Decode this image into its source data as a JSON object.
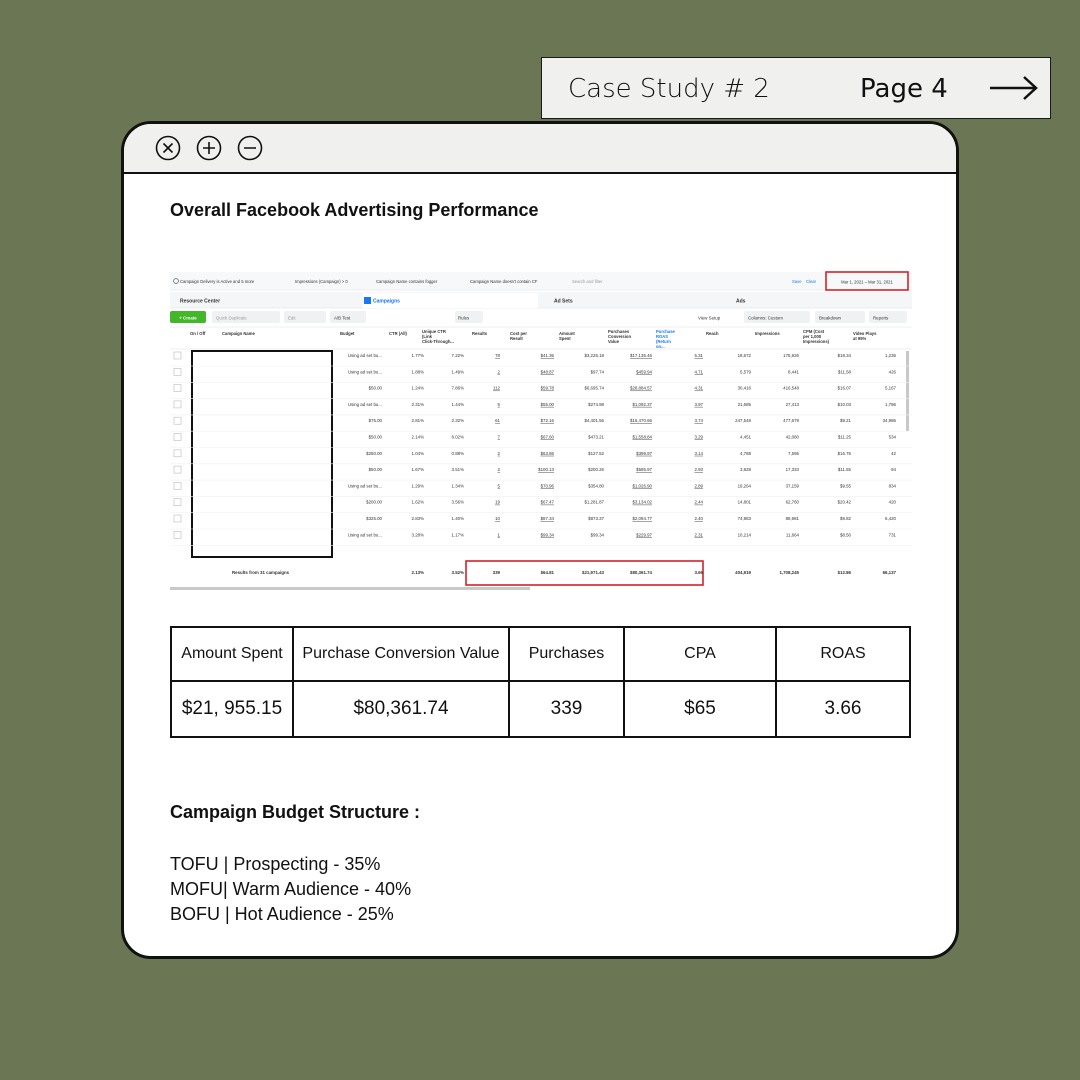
{
  "header_tab": {
    "title": "Case Study # 2",
    "page": "Page 4",
    "arrow_icon": "arrow-right-icon"
  },
  "window": {
    "controls": [
      "close-icon",
      "plus-icon",
      "minus-icon"
    ],
    "heading": "Overall  Facebook Advertising Performance"
  },
  "ads_manager": {
    "filters": [
      "Campaign Delivery is Active and 5 more",
      "Impressions (Campaign) > 0",
      "Campaign Name contains fogger",
      "Campaign Name doesn't contain CF"
    ],
    "search_placeholder": "Search and filter",
    "save_label": "Save",
    "clear_label": "Clear",
    "date_range": "Mar 1, 2021 – Mar 31, 2021",
    "tabs": [
      "Resource Center",
      "Campaigns",
      "Ad Sets",
      "Ads"
    ],
    "toolbar": {
      "create": "+ Create",
      "duplicate": "Quick Duplicate",
      "edit": "Edit",
      "ab_test": "A/B Test",
      "rules": "Rules",
      "view_setup": "View Setup",
      "columns": "Columns: Custom",
      "breakdown": "Breakdown",
      "reports": "Reports"
    },
    "columns": [
      "On / Off",
      "Campaign Name",
      "Budget",
      "CTR (All)",
      "Unique CTR (Link Click-Through...",
      "Results",
      "Cost per Result",
      "Amount Spent",
      "Purchases Conversion Value",
      "Purchase ROAS (Return on...",
      "Reach",
      "Impressions",
      "CPM (Cost per 1,000 Impressions)",
      "Video Plays at 95%"
    ],
    "rows": [
      [
        "Using ad set bu...",
        "1.77%",
        "7.22%",
        "78",
        "$41.36",
        "$3,226.18",
        "$17,135.46",
        "5.31",
        "18,672",
        "175,926",
        "$18.34",
        "1,236"
      ],
      [
        "Using ad set bu...",
        "1.88%",
        "1.49%",
        "2",
        "$48.87",
        "$97.74",
        "$459.94",
        "4.71",
        "5,579",
        "8,441",
        "$11.58",
        "426"
      ],
      [
        "$50.00",
        "1.24%",
        "7.86%",
        "112",
        "$59.78",
        "$6,695.74",
        "$28,884.57",
        "4.31",
        "30,416",
        "416,548",
        "$16.07",
        "5,167"
      ],
      [
        "Using ad set bu...",
        "2.31%",
        "1.44%",
        "5",
        "$55.00",
        "$274.98",
        "$1,092.37",
        "3.97",
        "21,685",
        "27,413",
        "$10.03",
        "1,786"
      ],
      [
        "$75.00",
        "2.81%",
        "2.32%",
        "61",
        "$72.16",
        "$4,401.56",
        "$16,470.66",
        "3.74",
        "247,548",
        "477,679",
        "$9.21",
        "34,986"
      ],
      [
        "$50.00",
        "2.14%",
        "8.02%",
        "7",
        "$67.60",
        "$473.21",
        "$1,558.84",
        "3.29",
        "4,451",
        "42,080",
        "$11.25",
        "534"
      ],
      [
        "$250.00",
        "1.04%",
        "0.88%",
        "2",
        "$63.86",
        "$127.52",
        "$399.97",
        "3.14",
        "4,788",
        "7,595",
        "$16.76",
        "42"
      ],
      [
        "$50.00",
        "1.67%",
        "3.51%",
        "2",
        "$100.13",
        "$200.26",
        "$585.97",
        "2.93",
        "3,928",
        "17,333",
        "$11.55",
        "94"
      ],
      [
        "Using ad set bu...",
        "1.29%",
        "1.34%",
        "5",
        "$70.96",
        "$354.80",
        "$1,026.90",
        "2.89",
        "19,264",
        "37,159",
        "$9.55",
        "834"
      ],
      [
        "$200.00",
        "1.62%",
        "3.56%",
        "19",
        "$67.47",
        "$1,281.87",
        "$3,134.02",
        "2.44",
        "14,801",
        "62,760",
        "$20.42",
        "420"
      ],
      [
        "$325.00",
        "2.83%",
        "1.40%",
        "10",
        "$87.34",
        "$873.37",
        "$2,094.77",
        "2.40",
        "74,983",
        "88,981",
        "$9.82",
        "6,420"
      ],
      [
        "Using ad set bu...",
        "3.28%",
        "1.17%",
        "1",
        "$99.34",
        "$99.34",
        "$229.97",
        "2.31",
        "10,214",
        "11,664",
        "$8.50",
        "731"
      ]
    ],
    "totals": {
      "label": "Results from 31 campaigns",
      "ctr": "2.13%",
      "unique_ctr": "3.52%",
      "results": "339",
      "cost_per_result": "$64.81",
      "amount_spent": "$21,971.43",
      "conversion_value": "$80,361.74",
      "roas": "3.66",
      "reach": "404,919",
      "impressions": "1,708,245",
      "cpm": "$12.86",
      "video_plays": "66,137"
    }
  },
  "summary_table": {
    "headers": [
      "Amount Spent",
      "Purchase Conversion Value",
      "Purchases",
      "CPA",
      "ROAS"
    ],
    "values": [
      "$21, 955.15",
      "$80,361.74",
      "339",
      "$65",
      "3.66"
    ]
  },
  "budget_section": {
    "heading": "Campaign Budget Structure :",
    "items": [
      "TOFU | Prospecting - 35%",
      "MOFU| Warm Audience - 40%",
      "BOFU | Hot Audience - 25%"
    ]
  }
}
